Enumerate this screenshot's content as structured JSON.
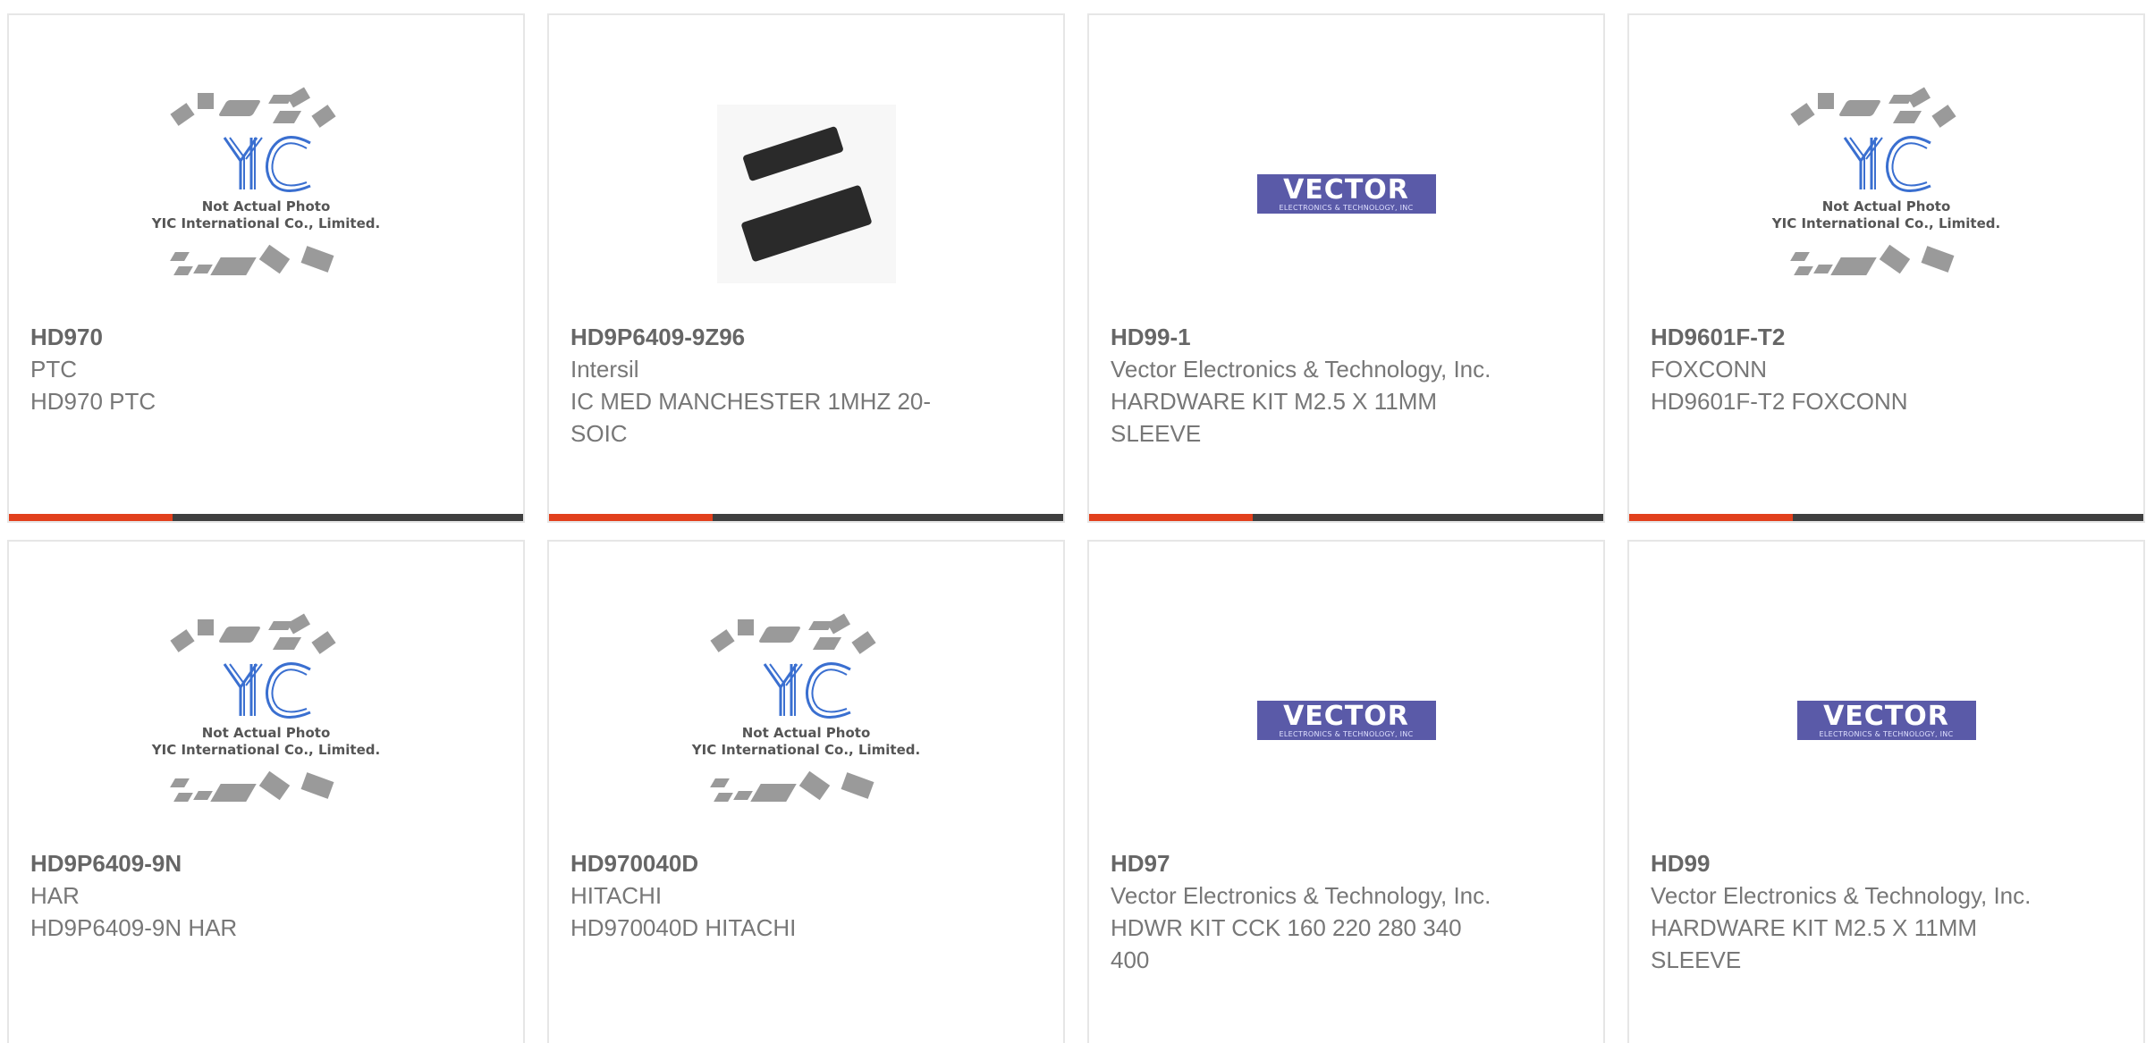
{
  "accent_color": "#e2401c",
  "bar_color": "#3f3f3f",
  "placeholder": {
    "line1": "Not Actual Photo",
    "line2": "YIC International Co., Limited.",
    "logo_text": "YIC"
  },
  "vector_logo": {
    "title": "VECTOR",
    "subtitle": "ELECTRONICS & TECHNOLOGY, INC"
  },
  "products": [
    {
      "part": "HD970",
      "maker": "PTC",
      "desc": "HD970 PTC",
      "image": "yic-placeholder"
    },
    {
      "part": "HD9P6409-9Z96",
      "maker": "Intersil",
      "desc": "IC MED MANCHESTER 1MHZ 20-SOIC",
      "image": "soic-photo"
    },
    {
      "part": "HD99-1",
      "maker": "Vector Electronics & Technology, Inc.",
      "desc": "HARDWARE KIT M2.5 X 11MM SLEEVE",
      "image": "vector-logo"
    },
    {
      "part": "HD9601F-T2",
      "maker": "FOXCONN",
      "desc": "HD9601F-T2 FOXCONN",
      "image": "yic-placeholder"
    },
    {
      "part": "HD9P6409-9N",
      "maker": "HAR",
      "desc": "HD9P6409-9N HAR",
      "image": "yic-placeholder"
    },
    {
      "part": "HD970040D",
      "maker": "HITACHI",
      "desc": "HD970040D HITACHI",
      "image": "yic-placeholder"
    },
    {
      "part": "HD97",
      "maker": "Vector Electronics & Technology, Inc.",
      "desc": "HDWR KIT CCK 160 220 280 340 400",
      "image": "vector-logo"
    },
    {
      "part": "HD99",
      "maker": "Vector Electronics & Technology, Inc.",
      "desc": "HARDWARE KIT M2.5 X 11MM SLEEVE",
      "image": "vector-logo"
    }
  ]
}
